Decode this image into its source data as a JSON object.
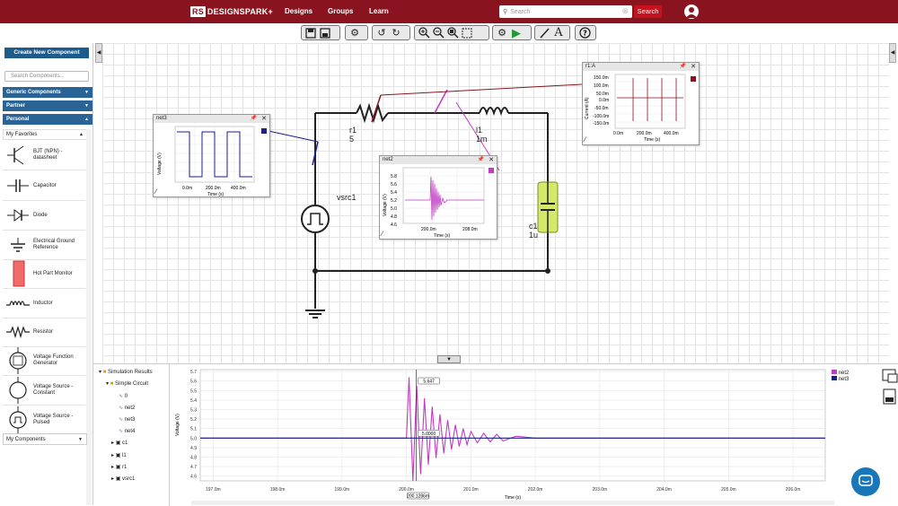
{
  "nav": {
    "logo_badge": "RS",
    "logo_text": "DESIGNSPARK+",
    "links": [
      "Designs",
      "Groups",
      "Learn"
    ],
    "search_placeholder": "Search",
    "search_button": "Search"
  },
  "toolbar": {
    "groups": [
      [
        "save-icon",
        "save-all-icon"
      ],
      [
        "settings-icon"
      ],
      [
        "undo-icon",
        "redo-icon"
      ],
      [
        "zoom-in-icon",
        "zoom-out-icon",
        "zoom-fit-icon",
        "select-area-icon"
      ],
      [
        "simulation-settings-icon",
        "run-simulation-icon"
      ],
      [
        "draw-wire-icon",
        "text-tool-icon"
      ],
      [
        "help-icon"
      ]
    ]
  },
  "sidebar": {
    "create_button": "Create New Component",
    "search_placeholder": "Search Components...",
    "categories": [
      "Generic Components",
      "Partner",
      "Personal"
    ],
    "favorites_header": "My Favorites",
    "favorites": [
      {
        "label": "BJT (NPN) - datasheet",
        "icon": "npn-transistor-icon"
      },
      {
        "label": "Capacitor",
        "icon": "capacitor-icon"
      },
      {
        "label": "Diode",
        "icon": "diode-icon"
      },
      {
        "label": "Electrical Ground Reference",
        "icon": "ground-icon"
      },
      {
        "label": "Hot Part Monitor",
        "icon": "hot-part-monitor-icon"
      },
      {
        "label": "Inductor",
        "icon": "inductor-icon"
      },
      {
        "label": "Resistor",
        "icon": "resistor-icon"
      },
      {
        "label": "Voltage Function Generator",
        "icon": "function-generator-icon"
      },
      {
        "label": "Voltage Source - Constant",
        "icon": "voltage-source-icon"
      },
      {
        "label": "Voltage Source - Pulsed",
        "icon": "pulsed-source-icon"
      }
    ],
    "my_components": "My Components"
  },
  "circuit": {
    "labels": {
      "r1": "r1",
      "r1_value": "5",
      "l1": "l1",
      "l1_value": "1m",
      "c1": "c1",
      "c1_value": "1u",
      "vsrc": "vsrc1"
    }
  },
  "probes": {
    "net3": {
      "title": "net3",
      "ylabel": "Voltage (V)",
      "xlabel": "Time (s)",
      "xticks": [
        "0.0m",
        "200.0m",
        "400.0m"
      ],
      "color": "#1b1f8a"
    },
    "net2": {
      "title": "net2",
      "ylabel": "Voltage (V)",
      "xlabel": "Time (s)",
      "xticks": [
        "200.0m",
        "208.0m"
      ],
      "yticks": [
        "5.8",
        "5.6",
        "5.4",
        "5.2",
        "5.0",
        "4.8",
        "4.6"
      ],
      "color": "#c03cc0"
    },
    "r1": {
      "title": "r1:A",
      "ylabel": "Current (A)",
      "xlabel": "Time (s)",
      "xticks": [
        "0.0m",
        "200.0m",
        "400.0m"
      ],
      "yticks": [
        "150.0m",
        "100.0m",
        "50.0m",
        "0.0m",
        "-50.0m",
        "-100.0m",
        "-150.0m"
      ],
      "color": "#8a1320"
    }
  },
  "results": {
    "tree": {
      "root": "Simulation Results",
      "circuit": "Simple Circuit",
      "nets": [
        "0",
        "net2",
        "net3",
        "net4"
      ],
      "components": [
        "c1",
        "l1",
        "r1",
        "vsrc1"
      ]
    },
    "plot": {
      "ylabel": "Voltage (V)",
      "xlabel": "Time (s)",
      "marker_top": "5.647",
      "marker_mid": "5.0000",
      "marker_x": "200.1286m",
      "legend": [
        {
          "name": "net2",
          "color": "#c03cc0"
        },
        {
          "name": "net3",
          "color": "#1b1f8a"
        }
      ]
    }
  },
  "chart_data": [
    {
      "type": "line",
      "xlabel": "Time (s)",
      "ylabel": "Voltage (V)",
      "x_ticks": [
        "197.0m",
        "198.0m",
        "199.0m",
        "200.0m",
        "201.0m",
        "202.0m",
        "203.0m",
        "204.0m",
        "205.0m",
        "206.0m"
      ],
      "y_ticks": [
        "5.7",
        "5.6",
        "5.5",
        "5.4",
        "5.3",
        "5.2",
        "5.1",
        "5.0",
        "4.9",
        "4.8",
        "4.7",
        "4.6"
      ],
      "xlim": [
        196.8,
        206.5
      ],
      "ylim": [
        4.55,
        5.72
      ],
      "series": [
        {
          "name": "net2",
          "color": "#c03cc0",
          "x": [
            196.8,
            200.0,
            200.04,
            200.1,
            200.16,
            200.22,
            200.28,
            200.34,
            200.4,
            200.46,
            200.52,
            200.58,
            200.64,
            200.7,
            200.76,
            200.82,
            200.88,
            200.94,
            201.0,
            201.1,
            201.2,
            201.3,
            201.4,
            201.5,
            201.7,
            202.0,
            206.5
          ],
          "y": [
            5.0,
            5.0,
            5.64,
            4.55,
            5.55,
            4.62,
            5.42,
            4.72,
            5.33,
            4.79,
            5.25,
            4.84,
            5.19,
            4.88,
            5.14,
            4.91,
            5.1,
            4.93,
            5.07,
            4.95,
            5.05,
            4.96,
            5.04,
            4.97,
            5.02,
            5.0,
            5.0
          ]
        },
        {
          "name": "net3",
          "color": "#1b1f8a",
          "x": [
            196.8,
            199.99,
            200.0,
            206.5
          ],
          "y": [
            5.0,
            5.0,
            5.0,
            5.0
          ]
        }
      ]
    }
  ]
}
